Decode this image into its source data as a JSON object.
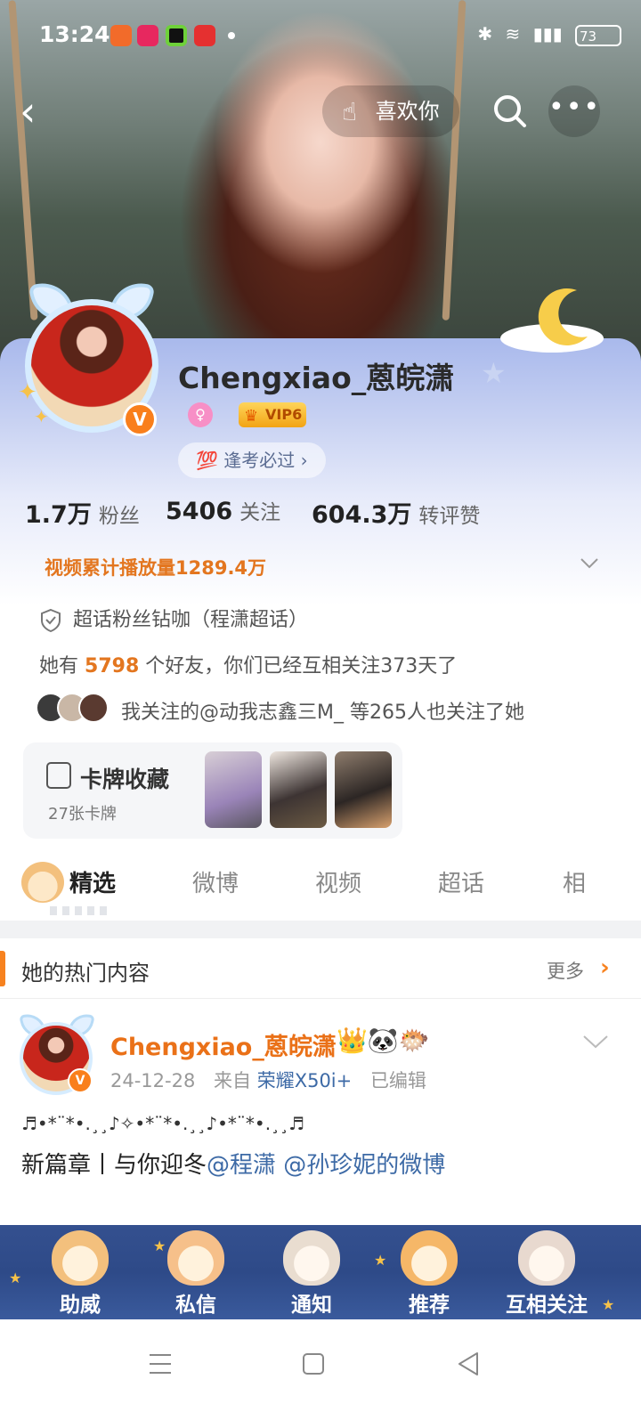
{
  "status_bar": {
    "time": "13:24",
    "battery": "73"
  },
  "header": {
    "like_label": "喜欢你"
  },
  "profile": {
    "username": "Chengxiao_蒽皖潇",
    "vip_label": "VIP6",
    "v_badge": "V",
    "tag": "💯 逢考必过 ›",
    "stats": [
      {
        "value": "1.7万",
        "label": "粉丝"
      },
      {
        "value": "5406",
        "label": "关注"
      },
      {
        "value": "604.3万",
        "label": "转评赞"
      }
    ],
    "video_plays": "视频累计播放量1289.4万",
    "supertopic": "超话粉丝钻咖（程潇超话）",
    "friends_prefix": "她有",
    "friends_count": "5798",
    "friends_suffix": "个好友，你们已经互相关注373天了",
    "mutual_text": "我关注的@动我志鑫三M_ 等265人也关注了她"
  },
  "cards": {
    "title": "卡牌收藏",
    "count": "27张卡牌"
  },
  "tabs": [
    {
      "label": "精选",
      "active": true
    },
    {
      "label": "微博",
      "active": false
    },
    {
      "label": "视频",
      "active": false
    },
    {
      "label": "超话",
      "active": false
    },
    {
      "label": "相",
      "active": false
    }
  ],
  "hot": {
    "title": "她的热门内容",
    "more": "更多"
  },
  "post": {
    "author": "Chengxiao_蒽皖潇",
    "badges": "👑🐼🐡",
    "date": "24-12-28",
    "from_label": "来自",
    "device": "荣耀X50i+",
    "edited": "已编辑",
    "deco_line": "♬•*¨*•.¸¸♪✧•*¨*•.¸¸♪•*¨*•.¸¸♬",
    "text_prefix": "新篇章丨与你迎冬",
    "mention1": "@程潇",
    "mention2": "@孙珍妮的微博"
  },
  "actions": [
    {
      "label": "助威",
      "color": "#f3c07d"
    },
    {
      "label": "私信",
      "color": "#f6c08a"
    },
    {
      "label": "通知",
      "color": "#e9ddd0"
    },
    {
      "label": "推荐",
      "color": "#f5b768"
    },
    {
      "label": "互相关注",
      "color": "#e8d9cf"
    }
  ],
  "colors": {
    "accent": "#f7821f",
    "link": "#3d6aa6",
    "vip": "#f2a314"
  }
}
